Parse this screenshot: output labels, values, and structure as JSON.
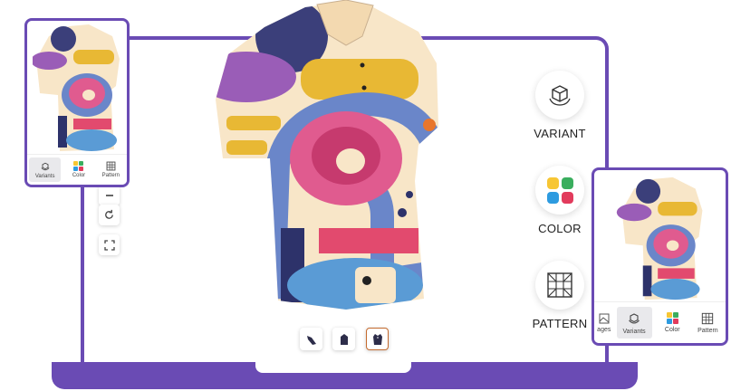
{
  "options": {
    "variant": {
      "label": "VARIANT",
      "icon": "cube-rotate-icon"
    },
    "color": {
      "label": "COLOR",
      "icon": "color-swatches-icon",
      "swatches": [
        "#f7c634",
        "#3aae5e",
        "#2d9be0",
        "#e23b5c"
      ]
    },
    "pattern": {
      "label": "PATTERN",
      "icon": "pattern-grid-icon"
    }
  },
  "toolbar": {
    "icons": [
      "rotate-icon",
      "fullscreen-icon"
    ]
  },
  "views": [
    {
      "name": "side",
      "icon": "shirt-side-icon"
    },
    {
      "name": "back",
      "icon": "shirt-back-icon"
    },
    {
      "name": "front",
      "icon": "shirt-front-icon",
      "active": true
    }
  ],
  "left_card": {
    "tabs": [
      "Variants",
      "Color",
      "Pattern"
    ],
    "selected": "Variants"
  },
  "right_card": {
    "tabs": [
      "ages",
      "Variants",
      "Color",
      "Pattern"
    ],
    "selected": "Variants"
  },
  "colors": {
    "brand": "#6a4bb4",
    "shirt_base": "#f8e6c8"
  }
}
